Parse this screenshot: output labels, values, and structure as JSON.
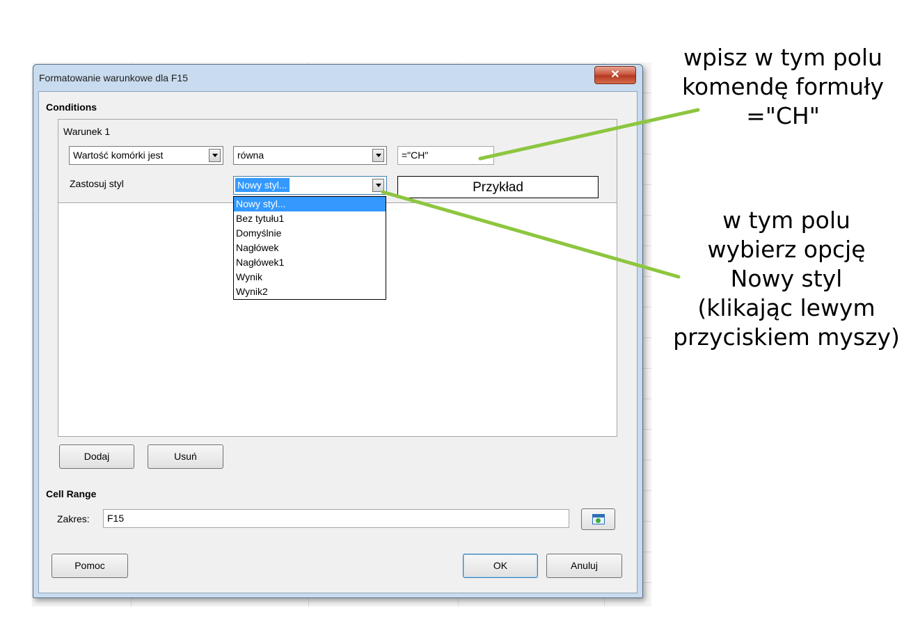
{
  "dialog": {
    "title": "Formatowanie warunkowe dla F15",
    "close_glyph": "✕",
    "conditions_heading": "Conditions",
    "condition": {
      "label": "Warunek 1",
      "type_select": "Wartość komórki jest",
      "operator_select": "równa",
      "value_input": "=\"CH\"",
      "apply_style_label": "Zastosuj styl",
      "style_select": "Nowy styl...",
      "preview_text": "Przykład",
      "style_options": [
        "Nowy styl...",
        "Bez tytułu1",
        "Domyślnie",
        "Nagłówek",
        "Nagłówek1",
        "Wynik",
        "Wynik2"
      ]
    },
    "buttons": {
      "add": "Dodaj",
      "remove": "Usuń",
      "help": "Pomoc",
      "ok": "OK",
      "cancel": "Anuluj"
    },
    "cell_range_heading": "Cell Range",
    "range_label": "Zakres:",
    "range_value": "F15"
  },
  "annotations": {
    "top": [
      "wpisz w tym polu",
      "komendę formuły",
      "=\"CH\""
    ],
    "bottom": [
      "w tym polu",
      "wybierz opcję",
      "Nowy styl",
      "(klikając lewym",
      "przyciskiem myszy)"
    ]
  },
  "colors": {
    "annotation_line": "#8dc63f",
    "selection": "#3399ff"
  }
}
